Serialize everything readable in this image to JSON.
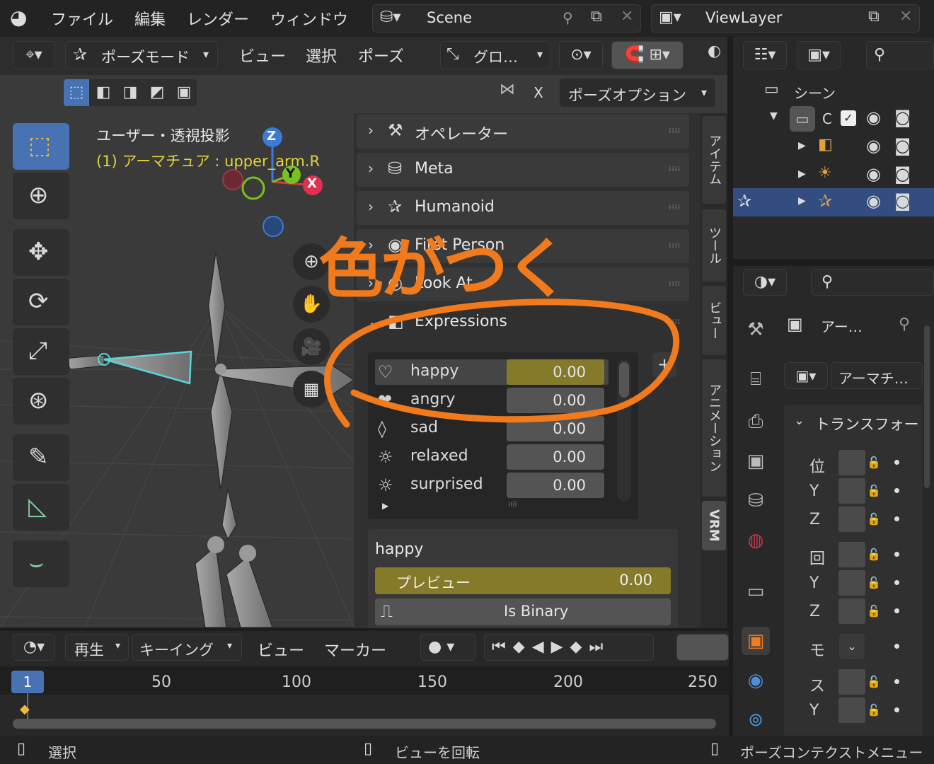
{
  "topbar": {
    "menu": [
      "ファイル",
      "編集",
      "レンダー",
      "ウィンドウ"
    ],
    "scene": "Scene",
    "view_layer": "ViewLayer"
  },
  "viewport_header": {
    "mode": "ポーズモード",
    "menus": [
      "ビュー",
      "選択",
      "ポーズ"
    ],
    "transform_orientation": "グロ…",
    "x_mirror": "X",
    "pose_options": "ポーズオプション"
  },
  "viewport": {
    "view_name": "ユーザー・透視投影",
    "object_label": "(1) アーマチュア : upper_arm.R",
    "gizmo_axes": {
      "z": "Z",
      "y": "Y",
      "x": "X"
    }
  },
  "annotation": {
    "text": "色がつく",
    "color": "#f07a1c"
  },
  "npanel": {
    "sections": [
      {
        "label": "オペレーター",
        "icon": "tool-icon"
      },
      {
        "label": "Meta",
        "icon": "meta-icon"
      },
      {
        "label": "Humanoid",
        "icon": "humanoid-icon"
      },
      {
        "label": "First Person",
        "icon": "first-person-icon"
      },
      {
        "label": "Look At",
        "icon": "look-at-icon"
      },
      {
        "label": "Expressions",
        "icon": "expressions-icon"
      }
    ],
    "expressions": [
      {
        "name": "happy",
        "value": "0.00",
        "icon": "♡"
      },
      {
        "name": "angry",
        "value": "0.00",
        "icon": "❤"
      },
      {
        "name": "sad",
        "value": "0.00",
        "icon": "◊"
      },
      {
        "name": "relaxed",
        "value": "0.00",
        "icon": "☼"
      },
      {
        "name": "surprised",
        "value": "0.00",
        "icon": "☼"
      }
    ],
    "selected": "happy",
    "preview_label": "プレビュー",
    "preview_value": "0.00",
    "is_binary": "Is Binary",
    "tabs": [
      "アイテム",
      "ツール",
      "ビュー",
      "アニメーション",
      "VRM"
    ],
    "accent": "#847a2a"
  },
  "outliner": {
    "scene_item": "シーン",
    "collection": "C"
  },
  "properties": {
    "object_name": "アー…",
    "data_name": "アーマチ…",
    "transform": "トランスフォー",
    "rows": [
      "位",
      "Y",
      "Z",
      "回",
      "Y",
      "Z",
      "モ",
      "ス",
      "Y"
    ]
  },
  "timeline": {
    "menus": [
      "再生",
      "キーイング",
      "ビュー",
      "マーカー"
    ],
    "current_frame": "1",
    "ticks": [
      "50",
      "100",
      "150",
      "200",
      "250"
    ]
  },
  "statusbar": {
    "left": "選択",
    "middle": "ビューを回転",
    "right": "ポーズコンテクストメニュー"
  }
}
